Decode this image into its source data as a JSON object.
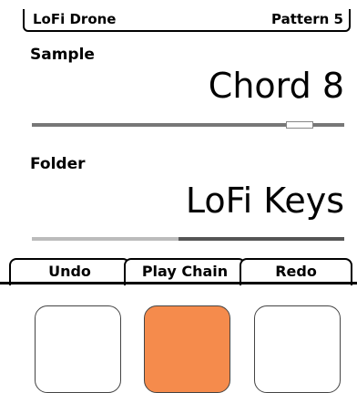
{
  "header": {
    "title": "LoFi Drone",
    "pattern": "Pattern 5"
  },
  "sample": {
    "label": "Sample",
    "value": "Chord 8",
    "position": 0.9
  },
  "folder": {
    "label": "Folder",
    "value": "LoFi Keys",
    "position": 0.47
  },
  "softkeys": {
    "left": "Undo",
    "center": "Play Chain",
    "right": "Redo"
  },
  "pads": [
    {
      "name": "left",
      "color": "#ffffff"
    },
    {
      "name": "center",
      "color": "#f58b4c"
    },
    {
      "name": "right",
      "color": "#ffffff"
    }
  ]
}
